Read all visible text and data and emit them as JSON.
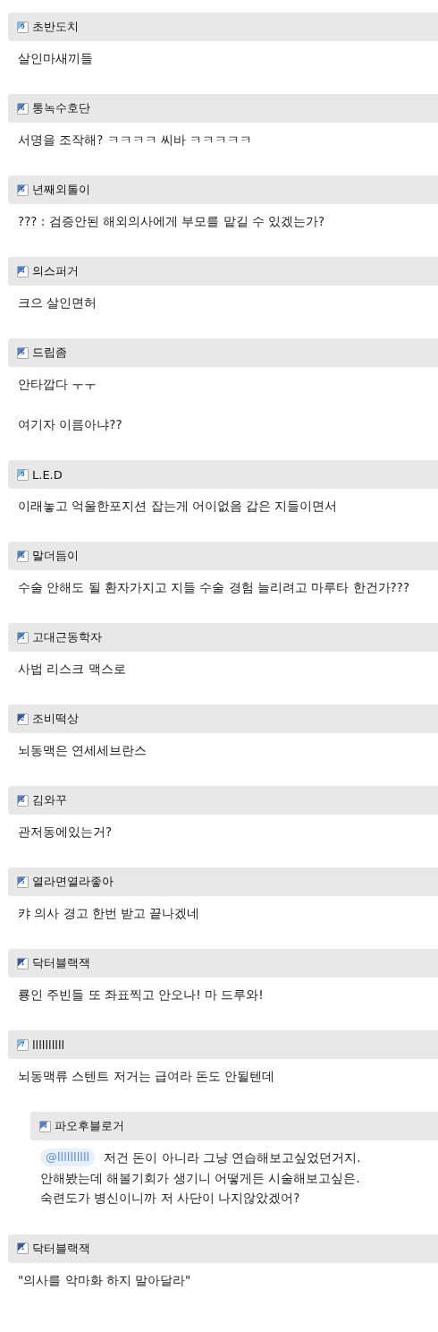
{
  "comments": [
    {
      "kind": "comment",
      "level": "9",
      "color": "#6ec6f5",
      "name": "초반도치",
      "paragraphs": [
        "살인마새끼들"
      ]
    },
    {
      "kind": "comment",
      "level": "6",
      "color": "#4a86d8",
      "name": "통녹수호단",
      "paragraphs": [
        "서명을 조작해? ㅋㅋㅋㅋ 씨바 ㅋㅋㅋㅋㅋ"
      ]
    },
    {
      "kind": "comment",
      "level": "6",
      "color": "#4a86d8",
      "name": "년째외톨이",
      "paragraphs": [
        "??? : 검증안된 해외의사에게 부모를 맡길 수 있겠는가?"
      ]
    },
    {
      "kind": "comment",
      "level": "4",
      "color": "#4a86d8",
      "name": "의스퍼거",
      "paragraphs": [
        "크으 살인면허"
      ]
    },
    {
      "kind": "comment",
      "level": "6",
      "color": "#4a86d8",
      "name": "드립좀",
      "paragraphs": [
        "안타깝다 ㅜㅜ",
        "여기자 이름아냐??"
      ]
    },
    {
      "kind": "comment",
      "level": "9",
      "color": "#6ec6f5",
      "name": "L.E.D",
      "paragraphs": [
        "이래놓고 억울한포지션 잡는게 어이없음 갑은 지들이면서"
      ]
    },
    {
      "kind": "comment",
      "level": "6",
      "color": "#4a86d8",
      "name": "말더듬이",
      "paragraphs": [
        "수술 안해도 될 환자가지고 지들 수술 경험 늘리려고 마루타 한건가???"
      ]
    },
    {
      "kind": "comment",
      "level": "5",
      "color": "#4a86d8",
      "name": "고대근동학자",
      "paragraphs": [
        "사법 리스크 맥스로"
      ]
    },
    {
      "kind": "comment",
      "level": "2",
      "color": "#2f5fb0",
      "name": "조비떡상",
      "paragraphs": [
        "뇌동맥은 연세세브란스"
      ]
    },
    {
      "kind": "comment",
      "level": "6",
      "color": "#4a86d8",
      "name": "김와꾸",
      "paragraphs": [
        "관저동에있는거?"
      ]
    },
    {
      "kind": "comment",
      "level": "5",
      "color": "#4a86d8",
      "name": "열라면열라좋아",
      "paragraphs": [
        "캬 의사 경고 한번 받고 끝나겠네"
      ]
    },
    {
      "kind": "comment",
      "level": "1",
      "color": "#2f5fb0",
      "name": "닥터블랙잭",
      "paragraphs": [
        "룡인 주빈들 또 좌표찍고 안오나! 마 드루와!"
      ]
    },
    {
      "kind": "comment",
      "level": "7",
      "color": "#6ec6f5",
      "name": "llllllllll",
      "paragraphs": [
        "뇌동맥류 스텐트 저거는 급여라 돈도 안될텐데"
      ]
    },
    {
      "kind": "reply",
      "level": "4",
      "color": "#4a86d8",
      "name": "파오후블로거",
      "mention": "@llllllllll",
      "lines": [
        "저건 돈이 아니라 그냥 연습해보고싶었던거지.",
        "안해봤는데 해볼기회가 생기니 어떻게든 시술해보고싶은.",
        "숙련도가 병신이니까 저 사단이 나지않았겠어?"
      ]
    },
    {
      "kind": "comment",
      "level": "1",
      "color": "#2f5fb0",
      "name": "닥터블랙잭",
      "paragraphs": [
        "\"의사를 악마화 하지 말아달라\""
      ]
    }
  ]
}
